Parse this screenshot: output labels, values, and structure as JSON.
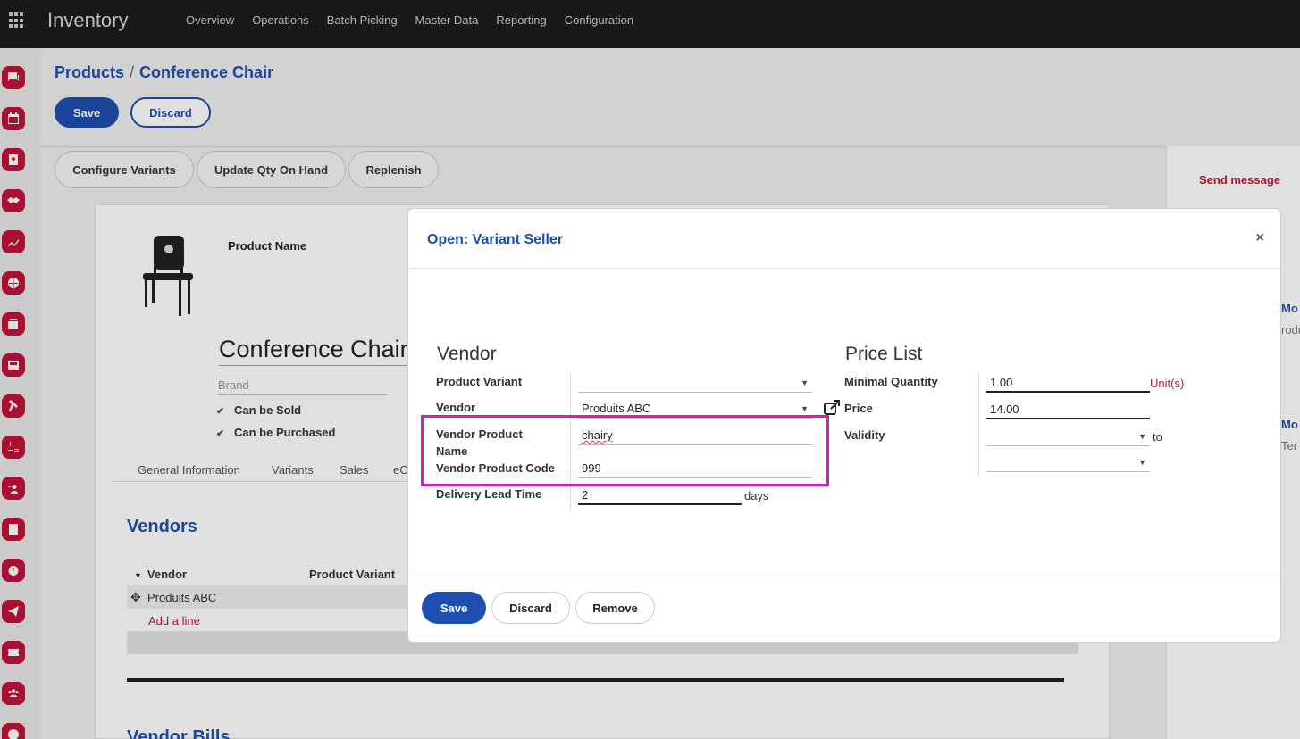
{
  "app": {
    "title": "Inventory",
    "menu": [
      "Overview",
      "Operations",
      "Batch Picking",
      "Master Data",
      "Reporting",
      "Configuration"
    ]
  },
  "dock_icons": [
    "discuss-icon",
    "calendar-icon",
    "contacts-icon",
    "crm-icon",
    "sales-icon",
    "website-icon",
    "pos-icon",
    "inventory-icon",
    "manufacturing-icon",
    "accounting-icon",
    "payroll-icon",
    "documents-icon",
    "time-off-icon",
    "email-marketing-icon",
    "events-icon",
    "employees-icon",
    "marketing-icon"
  ],
  "breadcrumb": {
    "parent": "Products",
    "current": "Conference Chair"
  },
  "control": {
    "save": "Save",
    "discard": "Discard"
  },
  "status_buttons": [
    "Configure Variants",
    "Update Qty On Hand",
    "Replenish"
  ],
  "chatter": {
    "send_message": "Send message",
    "side_texts": [
      "Mo",
      "rodu",
      "Mo",
      "Ter"
    ]
  },
  "product": {
    "name_label": "Product Name",
    "name": "Conference Chair",
    "brand_placeholder": "Brand",
    "can_be_sold": "Can be Sold",
    "can_be_purchased": "Can be Purchased",
    "tabs": [
      "General Information",
      "Variants",
      "Sales",
      "eC"
    ]
  },
  "vendors_section": {
    "title": "Vendors",
    "columns": [
      "Vendor",
      "Product Variant"
    ],
    "rows": [
      "Produits ABC"
    ],
    "add_line": "Add a line",
    "next_title": "Vendor Bills"
  },
  "modal": {
    "title": "Open: Variant Seller",
    "close": "×",
    "vendor_group": "Vendor",
    "price_group": "Price List",
    "labels": {
      "product_variant": "Product Variant",
      "vendor": "Vendor",
      "vendor_product_name_1": "Vendor Product",
      "vendor_product_name_2": "Name",
      "vendor_product_code": "Vendor Product Code",
      "delivery_lead_time": "Delivery Lead Time",
      "minimal_quantity": "Minimal Quantity",
      "price": "Price",
      "validity": "Validity"
    },
    "values": {
      "product_variant": "",
      "vendor": "Produits ABC",
      "vendor_product_name": "chairy",
      "vendor_product_code": "999",
      "delivery_lead_time": "2",
      "delivery_unit": "days",
      "minimal_quantity": "1.00",
      "quantity_unit": "Unit(s)",
      "price": "14.00",
      "validity_from": "",
      "validity_to_label": "to",
      "validity_to": ""
    },
    "buttons": {
      "save": "Save",
      "discard": "Discard",
      "remove": "Remove"
    }
  }
}
